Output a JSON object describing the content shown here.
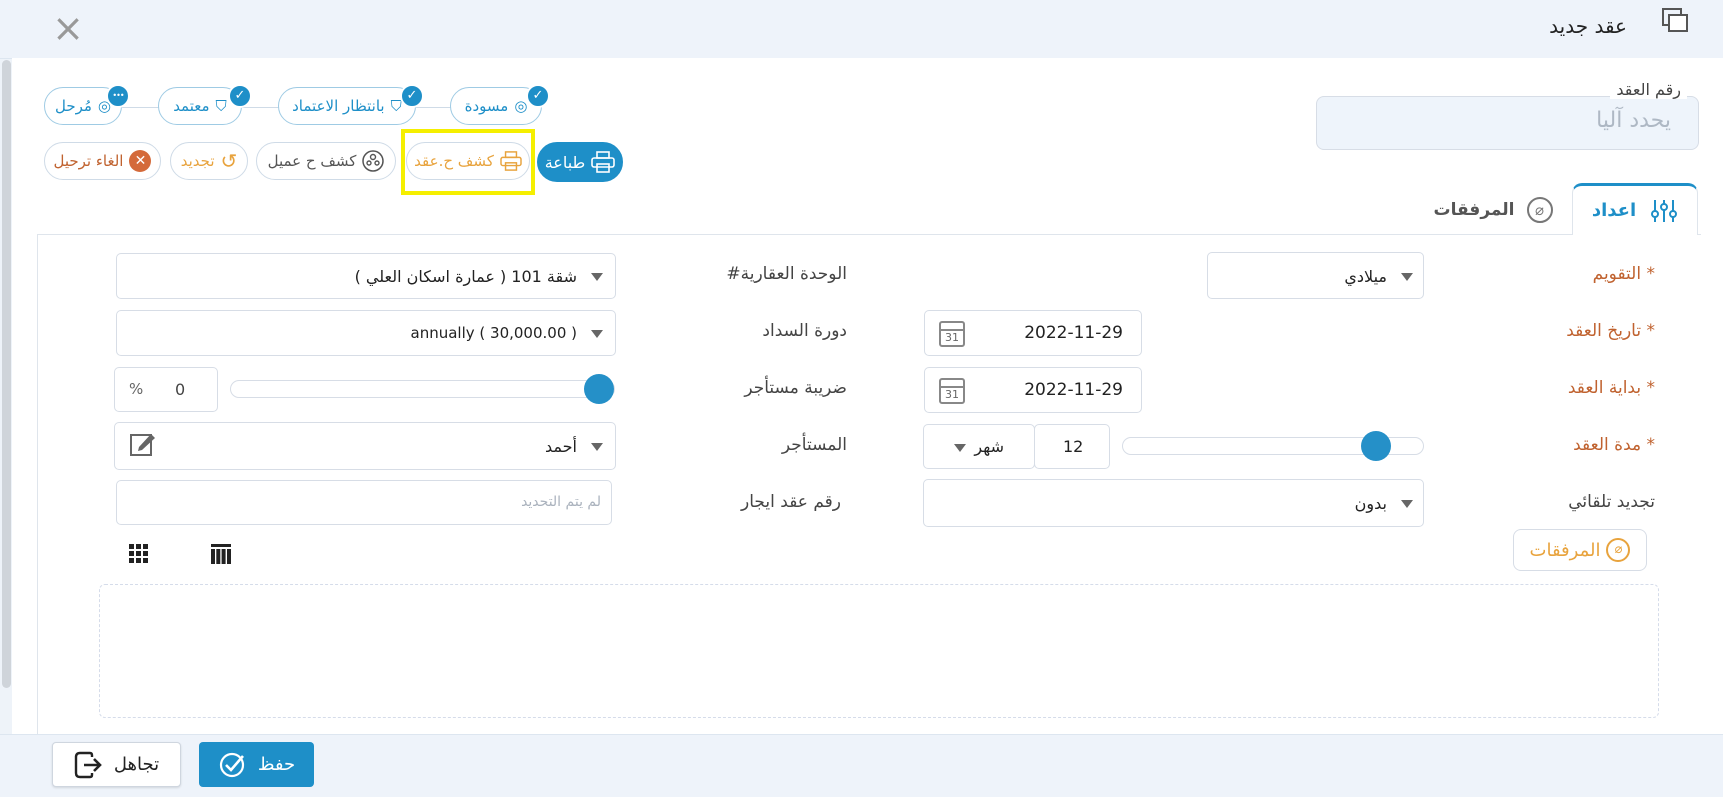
{
  "window": {
    "title": "عقد جديد",
    "close_icon": "close-icon",
    "window_icon": "windows-icon"
  },
  "contract_number": {
    "label": "رقم العقد",
    "placeholder": "يحدد آليا"
  },
  "statuses": [
    {
      "label": "مسودة",
      "badge": "✓"
    },
    {
      "label": "بانتظار الاعتماد",
      "badge": "✓"
    },
    {
      "label": "معتمد",
      "badge": "✓"
    },
    {
      "label": "مُرحل",
      "badge": "•••"
    }
  ],
  "actions": {
    "print": "طباعة",
    "contract_statement": "كشف ح.عقد",
    "client_statement": "كشف ح عميل",
    "renew": "تجديد",
    "cancel_posting": "الغاء ترحيل"
  },
  "tabs": {
    "settings": "اعداد",
    "attachments": "المرفقات"
  },
  "form": {
    "calendar": {
      "label": "التقويم *",
      "value": "ميلادي"
    },
    "contract_date": {
      "label": "تاريخ العقد *",
      "value": "2022-11-29",
      "cal_day": "31"
    },
    "contract_start": {
      "label": "بداية العقد *",
      "value": "2022-11-29",
      "cal_day": "31"
    },
    "contract_duration": {
      "label": "مدة العقد *",
      "value": "12",
      "unit": "شهر",
      "slider_level": 0.88
    },
    "auto_renew": {
      "label": "تجديد تلقائي",
      "value": "بدون"
    },
    "property_unit": {
      "label": "#الوحدة العقارية",
      "value": "شقة 101 ( عمارة اسكان العلي )"
    },
    "payment_cycle": {
      "label": "دورة السداد",
      "value": "annually ( 30,000.00 )"
    },
    "tenant_tax": {
      "label": "ضريبة مستأجر",
      "value": "0",
      "unit": "%",
      "slider_level": 1.0
    },
    "tenant": {
      "label": "المستأجر",
      "value": "أحمد"
    },
    "lease_number": {
      "label": "رقم عقد ايجار",
      "placeholder": "لم يتم التحديد"
    }
  },
  "attachments_button": "المرفقات",
  "footer": {
    "save": "حفظ",
    "ignore": "تجاهل"
  },
  "colors": {
    "accent": "#1e8fc8",
    "required_label": "#c0622f",
    "orange": "#e8a33d",
    "highlight": "#f5ef00"
  }
}
